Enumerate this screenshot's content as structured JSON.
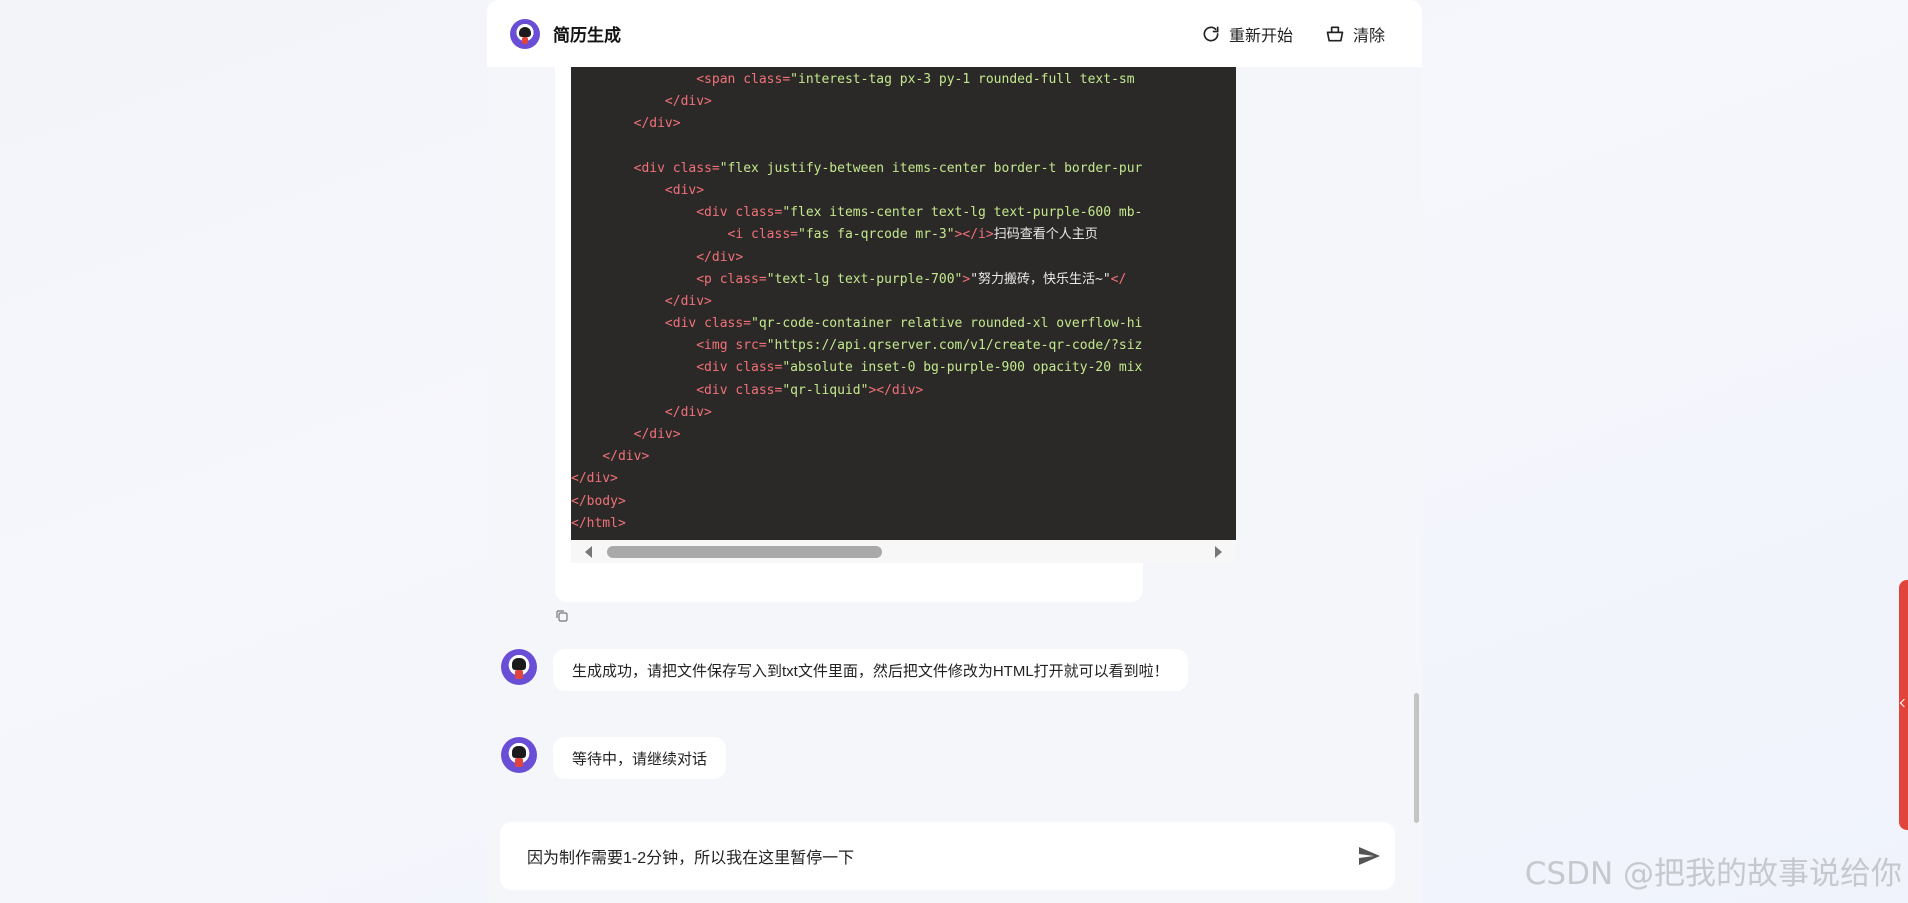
{
  "header": {
    "title": "简历生成",
    "restart_label": "重新开始",
    "clear_label": "清除"
  },
  "code_lines": [
    {
      "indent": "                ",
      "html": "<span class=\"tag\">&lt;span </span><span class=\"attr\">class</span><span class=\"tag\">=</span><span class=\"str\">\"interest-tag px-3 py-1 rounded-full text-sm</span>"
    },
    {
      "indent": "            ",
      "html": "<span class=\"tag\">&lt;/div&gt;</span>"
    },
    {
      "indent": "        ",
      "html": "<span class=\"tag\">&lt;/div&gt;</span>"
    },
    {
      "indent": "",
      "html": ""
    },
    {
      "indent": "        ",
      "html": "<span class=\"tag\">&lt;div </span><span class=\"attr\">class</span><span class=\"tag\">=</span><span class=\"str\">\"flex justify-between items-center border-t border-pur</span>"
    },
    {
      "indent": "            ",
      "html": "<span class=\"tag\">&lt;div&gt;</span>"
    },
    {
      "indent": "                ",
      "html": "<span class=\"tag\">&lt;div </span><span class=\"attr\">class</span><span class=\"tag\">=</span><span class=\"str\">\"flex items-center text-lg text-purple-600 mb-</span>"
    },
    {
      "indent": "                    ",
      "html": "<span class=\"tag\">&lt;i </span><span class=\"attr\">class</span><span class=\"tag\">=</span><span class=\"str\">\"fas fa-qrcode mr-3\"</span><span class=\"tag\">&gt;&lt;/i&gt;</span><span class=\"txt\">扫码查看个人主页</span>"
    },
    {
      "indent": "                ",
      "html": "<span class=\"tag\">&lt;/div&gt;</span>"
    },
    {
      "indent": "                ",
      "html": "<span class=\"tag\">&lt;p </span><span class=\"attr\">class</span><span class=\"tag\">=</span><span class=\"str\">\"text-lg text-purple-700\"</span><span class=\"tag\">&gt;</span><span class=\"txt\">\"努力搬砖，快乐生活~\"</span><span class=\"tag\">&lt;/</span>"
    },
    {
      "indent": "            ",
      "html": "<span class=\"tag\">&lt;/div&gt;</span>"
    },
    {
      "indent": "            ",
      "html": "<span class=\"tag\">&lt;div </span><span class=\"attr\">class</span><span class=\"tag\">=</span><span class=\"str\">\"qr-code-container relative rounded-xl overflow-hi</span>"
    },
    {
      "indent": "                ",
      "html": "<span class=\"tag\">&lt;img </span><span class=\"attr\">src</span><span class=\"tag\">=</span><span class=\"str\">\"https://api.qrserver.com/v1/create-qr-code/?siz</span>"
    },
    {
      "indent": "                ",
      "html": "<span class=\"tag\">&lt;div </span><span class=\"attr\">class</span><span class=\"tag\">=</span><span class=\"str\">\"absolute inset-0 bg-purple-900 opacity-20 mix</span>"
    },
    {
      "indent": "                ",
      "html": "<span class=\"tag\">&lt;div </span><span class=\"attr\">class</span><span class=\"tag\">=</span><span class=\"str\">\"qr-liquid\"</span><span class=\"tag\">&gt;&lt;/div&gt;</span>"
    },
    {
      "indent": "            ",
      "html": "<span class=\"tag\">&lt;/div&gt;</span>"
    },
    {
      "indent": "        ",
      "html": "<span class=\"tag\">&lt;/div&gt;</span>"
    },
    {
      "indent": "    ",
      "html": "<span class=\"tag\">&lt;/div&gt;</span>"
    },
    {
      "indent": "",
      "html": "<span class=\"tag\">&lt;/div&gt;</span>"
    },
    {
      "indent": "",
      "html": "<span class=\"tag\">&lt;/body&gt;</span>"
    },
    {
      "indent": "",
      "html": "<span class=\"tag\">&lt;/html&gt;</span>"
    }
  ],
  "messages": [
    {
      "text": "生成成功，请把文件保存写入到txt文件里面，然后把文件修改为HTML打开就可以看到啦！"
    },
    {
      "text": "等待中，请继续对话"
    }
  ],
  "input": {
    "value": "因为制作需要1-2分钟，所以我在这里暂停一下"
  },
  "watermark": "CSDN @把我的故事说给你",
  "icons": {
    "restart": "refresh-icon",
    "clear": "basket-icon",
    "copy": "copy-icon",
    "send": "send-icon"
  },
  "colors": {
    "code_bg": "#2b2928",
    "tag": "#f07178",
    "string": "#c3e88d",
    "accent_side": "#e0443b"
  }
}
